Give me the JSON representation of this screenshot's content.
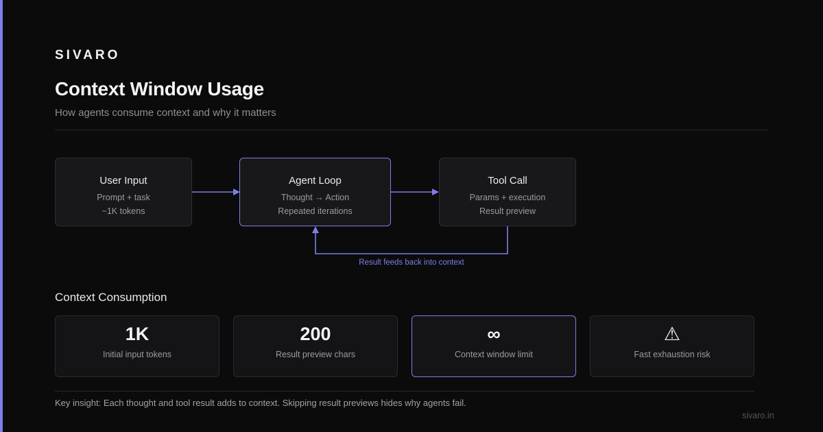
{
  "brand": "SIVARO",
  "title": "Context Window Usage",
  "subtitle": "How agents consume context and why it matters",
  "flow": {
    "nodes": [
      {
        "title": "User Input",
        "line1": "Prompt + task",
        "line2": "~1K tokens"
      },
      {
        "title": "Agent Loop",
        "line1": "Thought → Action",
        "line2": "Repeated iterations"
      },
      {
        "title": "Tool Call",
        "line1": "Params + execution",
        "line2": "Result preview"
      }
    ],
    "loop_label": "Result feeds back into context",
    "accent_color": "#7c7fe6"
  },
  "section_title": "Context Consumption",
  "metrics": [
    {
      "value": "1K",
      "label": "Initial input tokens"
    },
    {
      "value": "200",
      "label": "Result preview chars"
    },
    {
      "value": "∞",
      "label": "Context window limit"
    },
    {
      "value": "⚠",
      "label": "Fast exhaustion risk"
    }
  ],
  "insight": "Key insight: Each thought and tool result adds to context. Skipping result previews hides why agents fail.",
  "footer_url": "sivaro.in"
}
